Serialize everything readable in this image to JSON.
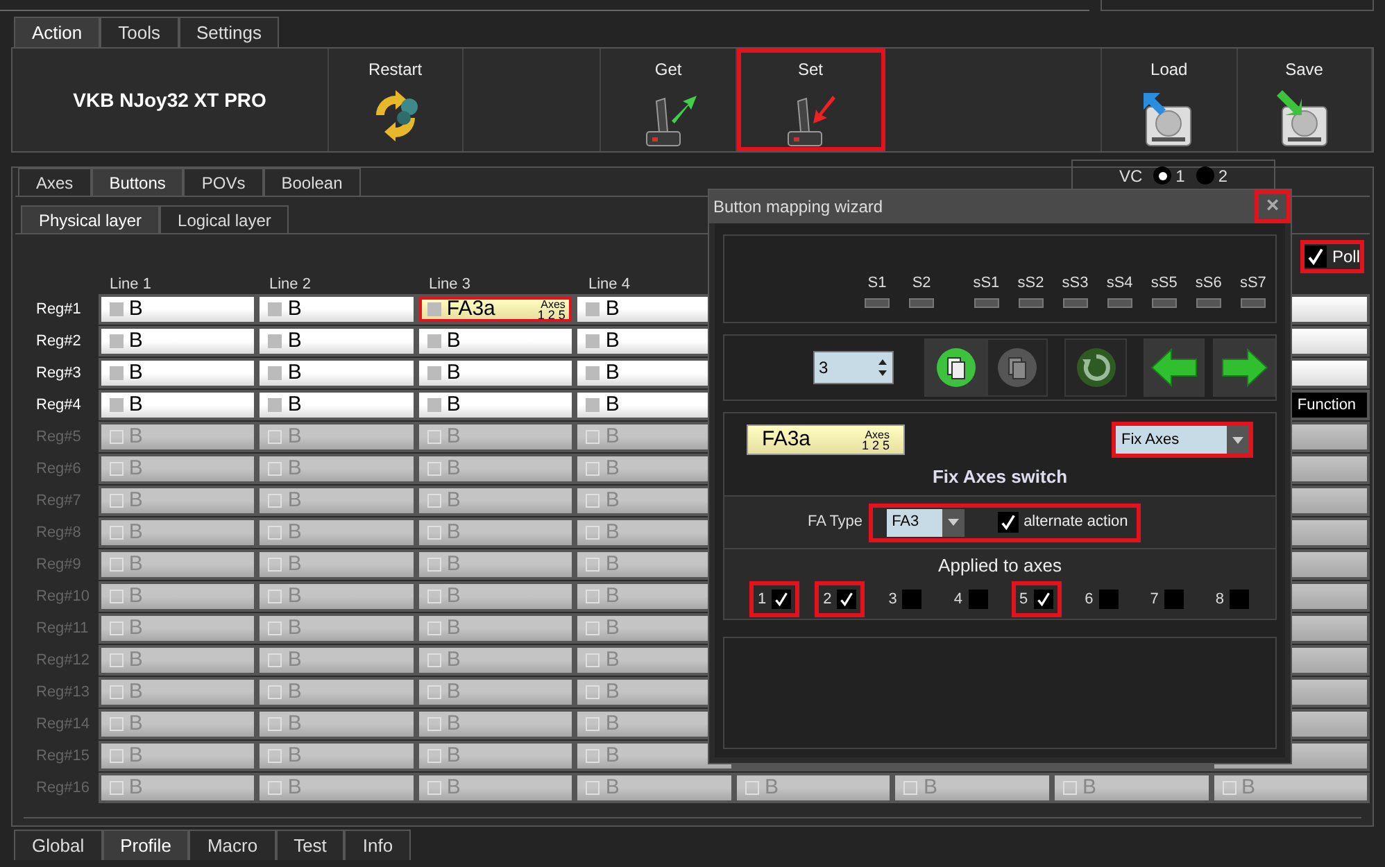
{
  "top_tabs": [
    {
      "label": "Action",
      "selected": true
    },
    {
      "label": "Tools",
      "selected": false
    },
    {
      "label": "Settings",
      "selected": false
    }
  ],
  "toolbar": {
    "device": "VKB NJoy32 XT PRO",
    "buttons": [
      {
        "label": "Restart",
        "kind": "restart",
        "highlighted": false
      },
      {
        "label": "Get",
        "kind": "get",
        "highlighted": false
      },
      {
        "label": "Set",
        "kind": "set",
        "highlighted": true
      },
      {
        "label": "Load",
        "kind": "load",
        "highlighted": false
      },
      {
        "label": "Save",
        "kind": "save",
        "highlighted": false
      }
    ]
  },
  "sub_tabs": [
    {
      "label": "Axes",
      "selected": false
    },
    {
      "label": "Buttons",
      "selected": true
    },
    {
      "label": "POVs",
      "selected": false
    },
    {
      "label": "Boolean",
      "selected": false
    }
  ],
  "vc": {
    "label": "VC",
    "options": [
      {
        "label": "1",
        "selected": true
      },
      {
        "label": "2",
        "selected": false
      }
    ]
  },
  "layer_tabs": [
    {
      "label": "Physical layer",
      "selected": true
    },
    {
      "label": "Logical layer",
      "selected": false
    }
  ],
  "poll": {
    "label": "Poll",
    "checked": true,
    "highlighted": true
  },
  "grid": {
    "columns": [
      "Line 1",
      "Line 2",
      "Line 3",
      "Line 4"
    ],
    "rows": [
      {
        "label": "Reg#1",
        "enabled": true,
        "cells": [
          {
            "kind": "button",
            "text": "B"
          },
          {
            "kind": "button",
            "text": "B"
          },
          {
            "kind": "fix_axes",
            "text": "FA3a",
            "tag": "Axes",
            "axes": "1 2 5",
            "highlighted": true
          },
          {
            "kind": "button",
            "text": "B"
          }
        ]
      },
      {
        "label": "Reg#2",
        "enabled": true,
        "cells": [
          {
            "kind": "button",
            "text": "B"
          },
          {
            "kind": "button",
            "text": "B"
          },
          {
            "kind": "button",
            "text": "B"
          },
          {
            "kind": "button",
            "text": "B"
          }
        ]
      },
      {
        "label": "Reg#3",
        "enabled": true,
        "cells": [
          {
            "kind": "button",
            "text": "B"
          },
          {
            "kind": "button",
            "text": "B"
          },
          {
            "kind": "button",
            "text": "B"
          },
          {
            "kind": "button",
            "text": "B"
          }
        ]
      },
      {
        "label": "Reg#4",
        "enabled": true,
        "cells": [
          {
            "kind": "button",
            "text": "B"
          },
          {
            "kind": "button",
            "text": "B"
          },
          {
            "kind": "button",
            "text": "B"
          },
          {
            "kind": "button",
            "text": "B"
          }
        ],
        "tail": "Function"
      },
      {
        "label": "Reg#5",
        "enabled": false,
        "cells": [
          {
            "kind": "button",
            "text": "B"
          },
          {
            "kind": "button",
            "text": "B"
          },
          {
            "kind": "button",
            "text": "B"
          },
          {
            "kind": "button",
            "text": "B"
          }
        ]
      },
      {
        "label": "Reg#6",
        "enabled": false,
        "cells": [
          {
            "kind": "button",
            "text": "B"
          },
          {
            "kind": "button",
            "text": "B"
          },
          {
            "kind": "button",
            "text": "B"
          },
          {
            "kind": "button",
            "text": "B"
          }
        ]
      },
      {
        "label": "Reg#7",
        "enabled": false,
        "cells": [
          {
            "kind": "button",
            "text": "B"
          },
          {
            "kind": "button",
            "text": "B"
          },
          {
            "kind": "button",
            "text": "B"
          },
          {
            "kind": "button",
            "text": "B"
          }
        ]
      },
      {
        "label": "Reg#8",
        "enabled": false,
        "cells": [
          {
            "kind": "button",
            "text": "B"
          },
          {
            "kind": "button",
            "text": "B"
          },
          {
            "kind": "button",
            "text": "B"
          },
          {
            "kind": "button",
            "text": "B"
          }
        ]
      },
      {
        "label": "Reg#9",
        "enabled": false,
        "cells": [
          {
            "kind": "button",
            "text": "B"
          },
          {
            "kind": "button",
            "text": "B"
          },
          {
            "kind": "button",
            "text": "B"
          },
          {
            "kind": "button",
            "text": "B"
          }
        ]
      },
      {
        "label": "Reg#10",
        "enabled": false,
        "cells": [
          {
            "kind": "button",
            "text": "B"
          },
          {
            "kind": "button",
            "text": "B"
          },
          {
            "kind": "button",
            "text": "B"
          },
          {
            "kind": "button",
            "text": "B"
          }
        ]
      },
      {
        "label": "Reg#11",
        "enabled": false,
        "cells": [
          {
            "kind": "button",
            "text": "B"
          },
          {
            "kind": "button",
            "text": "B"
          },
          {
            "kind": "button",
            "text": "B"
          },
          {
            "kind": "button",
            "text": "B"
          }
        ]
      },
      {
        "label": "Reg#12",
        "enabled": false,
        "cells": [
          {
            "kind": "button",
            "text": "B"
          },
          {
            "kind": "button",
            "text": "B"
          },
          {
            "kind": "button",
            "text": "B"
          },
          {
            "kind": "button",
            "text": "B"
          }
        ]
      },
      {
        "label": "Reg#13",
        "enabled": false,
        "cells": [
          {
            "kind": "button",
            "text": "B"
          },
          {
            "kind": "button",
            "text": "B"
          },
          {
            "kind": "button",
            "text": "B"
          },
          {
            "kind": "button",
            "text": "B"
          }
        ]
      },
      {
        "label": "Reg#14",
        "enabled": false,
        "cells": [
          {
            "kind": "button",
            "text": "B"
          },
          {
            "kind": "button",
            "text": "B"
          },
          {
            "kind": "button",
            "text": "B"
          },
          {
            "kind": "button",
            "text": "B"
          }
        ]
      },
      {
        "label": "Reg#15",
        "enabled": false,
        "cells": [
          {
            "kind": "button",
            "text": "B"
          },
          {
            "kind": "button",
            "text": "B"
          },
          {
            "kind": "button",
            "text": "B"
          },
          {
            "kind": "button",
            "text": "B"
          }
        ]
      },
      {
        "label": "Reg#16",
        "enabled": false,
        "cells": [
          {
            "kind": "button",
            "text": "B"
          },
          {
            "kind": "button",
            "text": "B"
          },
          {
            "kind": "button",
            "text": "B"
          },
          {
            "kind": "button",
            "text": "B"
          },
          {
            "kind": "button",
            "text": "B"
          },
          {
            "kind": "button",
            "text": "B"
          },
          {
            "kind": "button",
            "text": "B"
          },
          {
            "kind": "button",
            "text": "B"
          }
        ]
      }
    ]
  },
  "bottom_tabs": [
    {
      "label": "Global",
      "selected": false
    },
    {
      "label": "Profile",
      "selected": true
    },
    {
      "label": "Macro",
      "selected": false
    },
    {
      "label": "Test",
      "selected": false
    },
    {
      "label": "Info",
      "selected": false
    }
  ],
  "wizard": {
    "title": "Button mapping wizard",
    "close": {
      "label": "×",
      "highlighted": true
    },
    "shifts": [
      "S1",
      "S2"
    ],
    "sub_shifts": [
      "sS1",
      "sS2",
      "sS3",
      "sS4",
      "sS5",
      "sS6",
      "sS7"
    ],
    "spinner": {
      "value": "3"
    },
    "tools": [
      {
        "kind": "copy",
        "disabled": false
      },
      {
        "kind": "paste",
        "disabled": true
      },
      {
        "kind": "reset",
        "disabled": true
      },
      {
        "kind": "left",
        "disabled": false
      },
      {
        "kind": "right",
        "disabled": false
      }
    ],
    "preview": {
      "text": "FA3a",
      "tag": "Axes",
      "axes": "1 2 5"
    },
    "function_select": {
      "value": "Fix Axes",
      "highlighted": true
    },
    "heading": "Fix Axes switch",
    "fa_type": {
      "label": "FA Type",
      "value": "FA3",
      "highlighted": true
    },
    "alternate": {
      "label": "alternate action",
      "checked": true
    },
    "axes": {
      "label": "Applied to axes",
      "items": [
        {
          "label": "1",
          "checked": true,
          "highlighted": true
        },
        {
          "label": "2",
          "checked": true,
          "highlighted": true
        },
        {
          "label": "3",
          "checked": false,
          "highlighted": false
        },
        {
          "label": "4",
          "checked": false,
          "highlighted": false
        },
        {
          "label": "5",
          "checked": true,
          "highlighted": true
        },
        {
          "label": "6",
          "checked": false,
          "highlighted": false
        },
        {
          "label": "7",
          "checked": false,
          "highlighted": false
        },
        {
          "label": "8",
          "checked": false,
          "highlighted": false
        }
      ]
    }
  }
}
